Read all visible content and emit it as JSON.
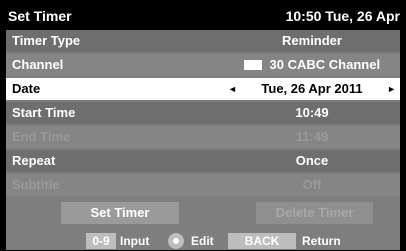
{
  "header": {
    "title": "Set Timer",
    "datetime": "10:50 Tue, 26 Apr"
  },
  "fields": [
    {
      "label": "Timer Type",
      "value": "Reminder",
      "enabled": true
    },
    {
      "label": "Channel",
      "value": "30 CABC Channel",
      "enabled": true
    },
    {
      "label": "Date",
      "value": "Tue, 26 Apr 2011",
      "enabled": true,
      "selected": true
    },
    {
      "label": "Start Time",
      "value": "10:49",
      "enabled": true
    },
    {
      "label": "End Time",
      "value": "11:49",
      "enabled": false
    },
    {
      "label": "Repeat",
      "value": "Once",
      "enabled": true
    },
    {
      "label": "Subtitle",
      "value": "Off",
      "enabled": false
    }
  ],
  "buttons": {
    "set_timer": "Set Timer",
    "delete_timer": "Delete Timer"
  },
  "help": {
    "key1": "0-9",
    "label1": "Input",
    "label2": "Edit",
    "key3": "BACK",
    "label3": "Return"
  },
  "arrows": {
    "left": "◄",
    "right": "►"
  }
}
